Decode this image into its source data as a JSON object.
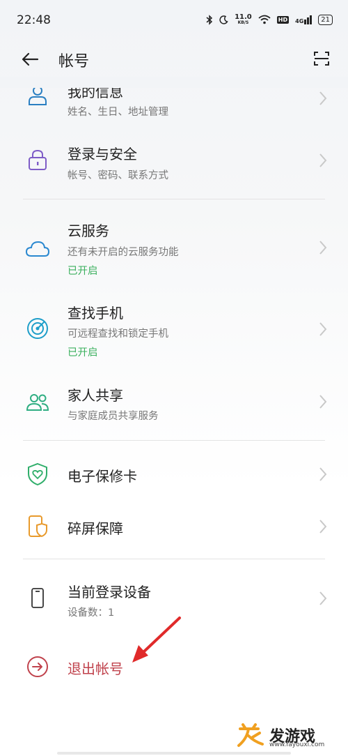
{
  "status_bar": {
    "time": "22:48",
    "net_speed_value": "11.0",
    "net_speed_unit": "KB/S",
    "hd": "HD",
    "network": "4G",
    "battery": "21",
    "icons": [
      "bluetooth-icon",
      "moon-icon",
      "wifi-icon",
      "signal-icon",
      "battery-icon"
    ]
  },
  "header": {
    "title": "帐号",
    "back_icon": "back-arrow-icon",
    "scan_icon": "scan-icon"
  },
  "items": [
    {
      "title": "我的信息",
      "subtitle": "姓名、生日、地址管理",
      "icon": "person-icon"
    },
    {
      "title": "登录与安全",
      "subtitle": "帐号、密码、联系方式",
      "icon": "lock-icon"
    },
    {
      "title": "云服务",
      "subtitle": "还有未开启的云服务功能",
      "status": "已开启",
      "icon": "cloud-icon"
    },
    {
      "title": "查找手机",
      "subtitle": "可远程查找和锁定手机",
      "status": "已开启",
      "icon": "target-icon"
    },
    {
      "title": "家人共享",
      "subtitle": "与家庭成员共享服务",
      "icon": "family-icon"
    },
    {
      "title": "电子保修卡",
      "icon": "shield-heart-icon"
    },
    {
      "title": "碎屏保障",
      "icon": "phone-protect-icon"
    },
    {
      "title": "当前登录设备",
      "subtitle": "设备数：1",
      "icon": "phone-icon"
    }
  ],
  "logout": {
    "label": "退出帐号",
    "icon": "logout-icon"
  },
  "watermark": {
    "text": "发游戏",
    "url": "www.fayouxi.com"
  },
  "colors": {
    "accent_green": "#3bb05e",
    "logout_red": "#c0424c",
    "annotation_arrow": "#e02a2a"
  }
}
